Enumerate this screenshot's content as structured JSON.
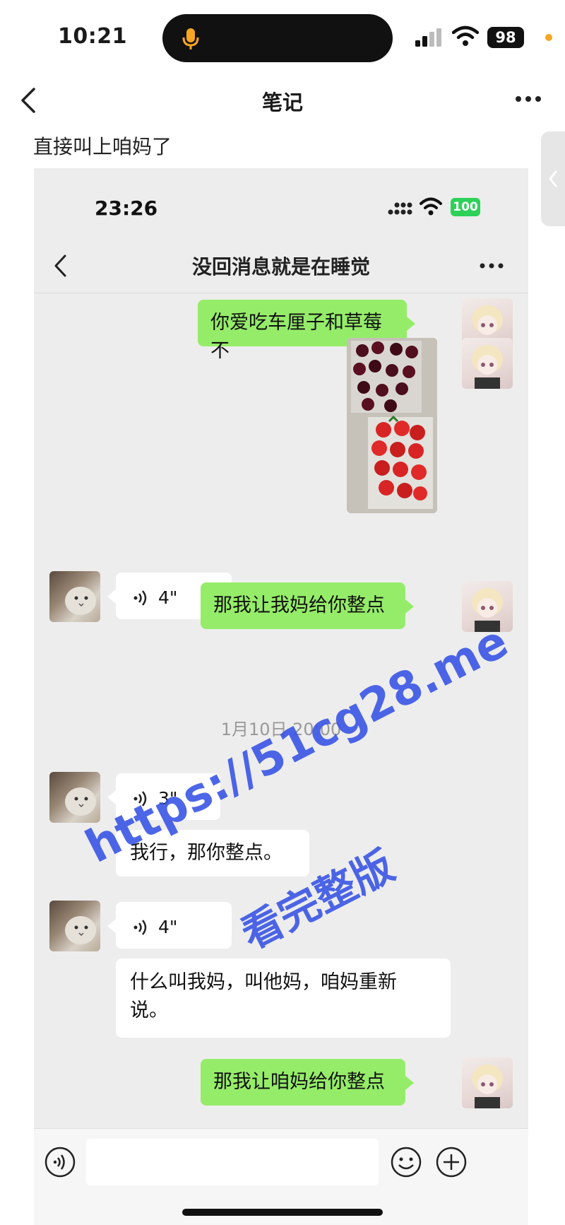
{
  "outer": {
    "status": {
      "time": "10:21",
      "battery": "98"
    },
    "nav": {
      "title": "笔记"
    },
    "caption": "直接叫上咱妈了"
  },
  "inner": {
    "status": {
      "time": "23:26",
      "battery": "100"
    },
    "chat_title": "没回消息就是在睡觉",
    "messages": [
      {
        "side": "right",
        "type": "text",
        "text": "你爱吃车厘子和草莓不"
      },
      {
        "side": "right",
        "type": "image",
        "alt": "cherries and strawberries photo"
      },
      {
        "side": "left",
        "type": "voice",
        "duration": "4\""
      },
      {
        "side": "right",
        "type": "text",
        "text": "那我让我妈给你整点"
      },
      {
        "type": "timestamp",
        "text": "1月10日 20:00"
      },
      {
        "side": "left",
        "type": "voice",
        "duration": "3\""
      },
      {
        "side": "left",
        "type": "text",
        "text": "我行，那你整点。"
      },
      {
        "side": "left",
        "type": "voice",
        "duration": "4\""
      },
      {
        "side": "left",
        "type": "text",
        "line1": "什么叫我妈，叫他妈，咱妈重新",
        "line2": "说。"
      },
      {
        "side": "right",
        "type": "text",
        "text": "那我让咱妈给你整点"
      }
    ]
  },
  "watermark": {
    "line1": "https://51cg28.me",
    "line2": "看完整版"
  },
  "colors": {
    "green_bubble": "#95ec69",
    "chat_bg": "#ededed",
    "watermark": "#3a56e6"
  },
  "icons": [
    "microphone-icon",
    "signal-icon",
    "wifi-icon",
    "battery-icon",
    "back-chevron-icon",
    "more-icon",
    "voice-wave-icon",
    "voice-input-icon",
    "emoji-icon",
    "plus-icon"
  ]
}
